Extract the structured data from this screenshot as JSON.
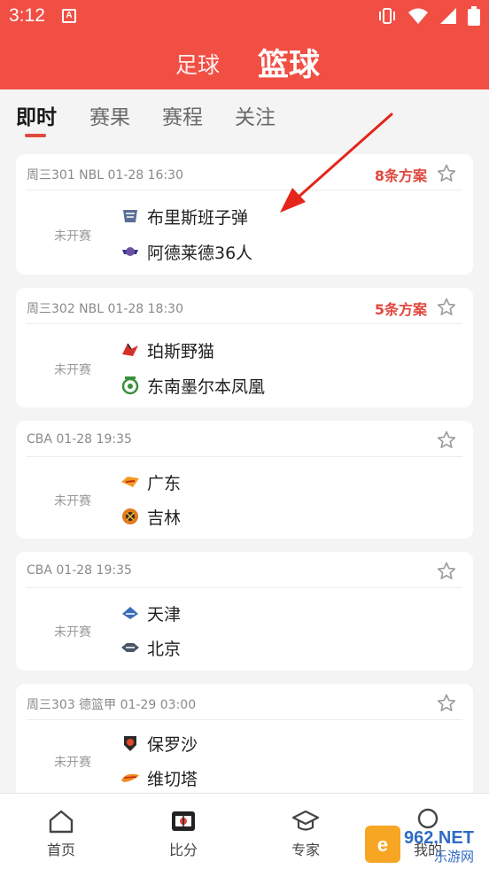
{
  "status_bar": {
    "time": "3:12",
    "app_badge": "A"
  },
  "sport_tabs": [
    {
      "label": "足球",
      "active": false
    },
    {
      "label": "篮球",
      "active": true
    }
  ],
  "sub_tabs": [
    {
      "label": "即时",
      "active": true
    },
    {
      "label": "赛果",
      "active": false
    },
    {
      "label": "赛程",
      "active": false
    },
    {
      "label": "关注",
      "active": false
    }
  ],
  "matches": [
    {
      "header": "周三301 NBL 01-28 16:30",
      "plans": "8条方案",
      "status": "未开赛",
      "home": {
        "name": "布里斯班子弹",
        "logo": "brisbane-bullets-logo"
      },
      "away": {
        "name": "阿德莱德36人",
        "logo": "adelaide-36ers-logo"
      }
    },
    {
      "header": "周三302 NBL 01-28 18:30",
      "plans": "5条方案",
      "status": "未开赛",
      "home": {
        "name": "珀斯野猫",
        "logo": "perth-wildcats-logo"
      },
      "away": {
        "name": "东南墨尔本凤凰",
        "logo": "se-melbourne-phoenix-logo"
      }
    },
    {
      "header": "CBA 01-28 19:35",
      "plans": "",
      "status": "未开赛",
      "home": {
        "name": "广东",
        "logo": "guangdong-logo"
      },
      "away": {
        "name": "吉林",
        "logo": "jilin-logo"
      }
    },
    {
      "header": "CBA 01-28 19:35",
      "plans": "",
      "status": "未开赛",
      "home": {
        "name": "天津",
        "logo": "tianjin-logo"
      },
      "away": {
        "name": "北京",
        "logo": "beijing-logo"
      }
    },
    {
      "header": "周三303 德篮甲 01-29 03:00",
      "plans": "",
      "status": "未开赛",
      "home": {
        "name": "保罗沙",
        "logo": "paulosa-logo"
      },
      "away": {
        "name": "维切塔",
        "logo": "vechta-logo"
      }
    }
  ],
  "bottom_nav": [
    {
      "label": "首页",
      "icon": "home-icon",
      "active": false
    },
    {
      "label": "比分",
      "icon": "scoreboard-icon",
      "active": true
    },
    {
      "label": "专家",
      "icon": "graduation-cap-icon",
      "active": false
    },
    {
      "label": "我的",
      "icon": "user-icon",
      "active": false
    }
  ],
  "watermark": {
    "text": "962.NET",
    "subtext": "乐游网"
  },
  "colors": {
    "brand": "#f14f44",
    "accent_red": "#e0483f",
    "background": "#f4f4f4"
  }
}
